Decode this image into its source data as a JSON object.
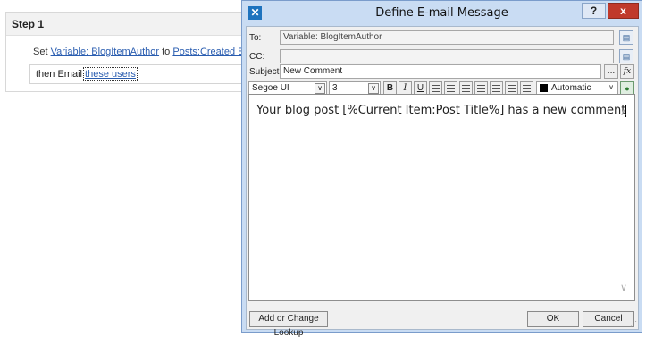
{
  "step": {
    "title": "Step 1",
    "set_text": "Set",
    "variable_link": "Variable: BlogItemAuthor",
    "to_text": "to",
    "posts_link": "Posts:Created By",
    "then_text": "then Email",
    "users_link": "these users"
  },
  "dialog": {
    "title": "Define E-mail Message",
    "help_label": "?",
    "close_label": "x",
    "to_label": "To:",
    "to_value": "Variable: BlogItemAuthor",
    "cc_label": "CC:",
    "cc_value": "",
    "subject_label": "Subject:",
    "subject_value": "New Comment",
    "ellipsis_label": "...",
    "fx_label": "fx",
    "font_name": "Segoe UI",
    "font_size": "3",
    "bold_label": "B",
    "italic_label": "I",
    "underline_label": "U",
    "color_label": "Automatic",
    "body_text": "Your blog post [%Current Item:Post Title%] has a new comment",
    "lookup_button": "Add or Change Lookup",
    "ok_button": "OK",
    "cancel_button": "Cancel"
  },
  "colors": {
    "title_bar": "#c9dcf3",
    "close_button": "#c0392b",
    "link": "#2a5db0"
  },
  "icons": [
    "address-book-icon",
    "formula-icon",
    "align-left-icon",
    "align-center-icon",
    "align-right-icon",
    "numbered-list-icon",
    "bulleted-list-icon",
    "outdent-icon",
    "indent-icon",
    "color-picker-icon",
    "resize-grip-icon"
  ]
}
